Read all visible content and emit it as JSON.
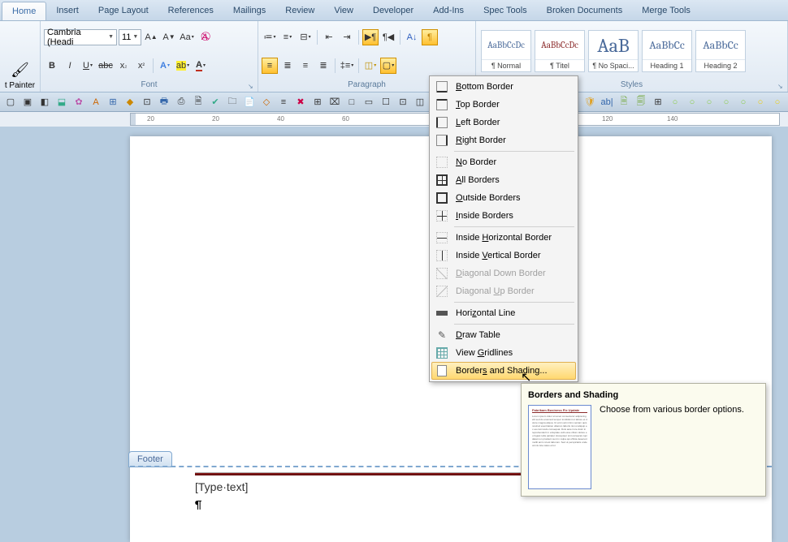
{
  "tabs": [
    "Home",
    "Insert",
    "Page Layout",
    "References",
    "Mailings",
    "Review",
    "View",
    "Developer",
    "Add-Ins",
    "Spec Tools",
    "Broken Documents",
    "Merge Tools"
  ],
  "active_tab": "Home",
  "painter_label": "t Painter",
  "font": {
    "name": "Cambria (Headi",
    "size": "11",
    "group_label": "Font"
  },
  "paragraph": {
    "group_label": "Paragraph"
  },
  "styles": {
    "group_label": "Styles",
    "items": [
      {
        "preview": "AaBbCcDc",
        "name": "¶ Normal"
      },
      {
        "preview": "AaBbCcDc",
        "name": "¶ Titel"
      },
      {
        "preview": "AaB",
        "name": "¶ No Spaci..."
      },
      {
        "preview": "AaBbCc",
        "name": "Heading 1"
      },
      {
        "preview": "AaBbCc",
        "name": "Heading 2"
      }
    ]
  },
  "ruler_ticks": [
    "20",
    "",
    "20",
    "",
    "40",
    "",
    "60",
    "",
    "120",
    "",
    "140"
  ],
  "footer": {
    "tab_label": "Footer",
    "placeholder": "[Type·text]",
    "tab_arrow": "→",
    "pilcrow": "¶"
  },
  "dropdown": {
    "items": [
      {
        "label": "Bottom Border",
        "u": "B",
        "icon": "bottom"
      },
      {
        "label": "Top Border",
        "u": "T",
        "icon": "top"
      },
      {
        "label": "Left Border",
        "u": "L",
        "icon": "leftb"
      },
      {
        "label": "Right Border",
        "u": "R",
        "icon": "rightb"
      },
      {
        "type": "sep"
      },
      {
        "label": "No Border",
        "u": "N",
        "icon": "none"
      },
      {
        "label": "All Borders",
        "u": "A",
        "icon": "all"
      },
      {
        "label": "Outside Borders",
        "u": "O",
        "icon": "outside"
      },
      {
        "label": "Inside Borders",
        "u": "I",
        "icon": "inside"
      },
      {
        "type": "sep"
      },
      {
        "label": "Inside Horizontal Border",
        "u": "H",
        "icon": "insh"
      },
      {
        "label": "Inside Vertical Border",
        "u": "V",
        "icon": "insv"
      },
      {
        "label": "Diagonal Down Border",
        "u": "D",
        "icon": "diag1",
        "disabled": true
      },
      {
        "label": "Diagonal Up Border",
        "u": "U",
        "icon": "diag2",
        "disabled": true
      },
      {
        "type": "sep"
      },
      {
        "label": "Horizontal Line",
        "u": "Z",
        "icon": "hr"
      },
      {
        "type": "sep"
      },
      {
        "label": "Draw Table",
        "u": "D",
        "icon": "pencil"
      },
      {
        "label": "View Gridlines",
        "u": "G",
        "icon": "grid"
      },
      {
        "label": "Borders and Shading...",
        "u": "S",
        "icon": "page",
        "highlight": true
      }
    ]
  },
  "tooltip": {
    "title": "Borders and Shading",
    "desc": "Choose from various border options.",
    "thumb_title": "Fabrikam Business Fix Update"
  }
}
